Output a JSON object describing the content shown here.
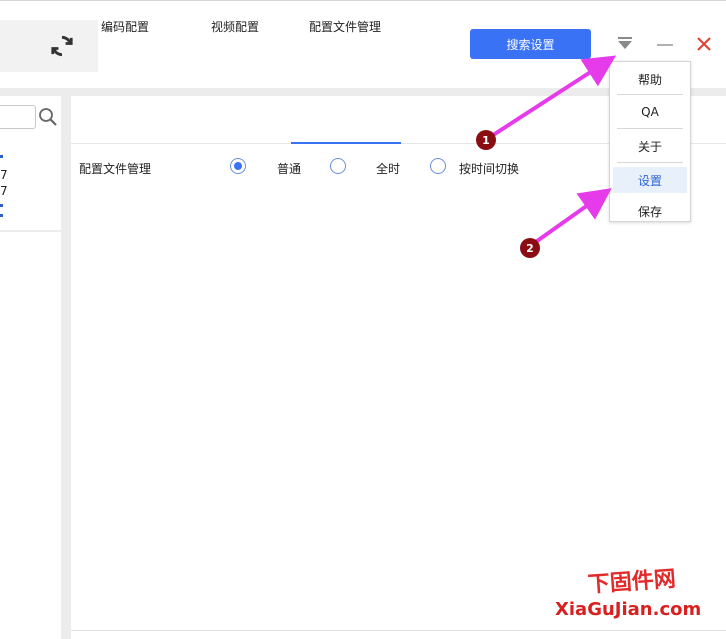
{
  "toolbar": {
    "search_settings_label": "搜索设置",
    "refresh_icon": "refresh-icon",
    "dropdown_icon": "dropdown-triangle-icon",
    "minimize_icon": "minimize-icon",
    "close_icon": "close-icon",
    "close_color": "#e0443c",
    "accent_color": "#3a72f5"
  },
  "left_panel": {
    "search_icon": "search-icon",
    "items": [
      "7",
      "7"
    ]
  },
  "tabs": [
    {
      "label": "编码配置"
    },
    {
      "label": "视频配置"
    },
    {
      "label": "配置文件管理",
      "active": true
    }
  ],
  "config_row": {
    "label": "配置文件管理",
    "options": [
      {
        "label": "普通",
        "checked": true
      },
      {
        "label": "全时",
        "checked": false
      },
      {
        "label": "按时间切换",
        "checked": false
      }
    ]
  },
  "menu": {
    "items": [
      {
        "label": "帮助"
      },
      {
        "label": "QA"
      },
      {
        "label": "关于"
      },
      {
        "label": "设置",
        "highlighted": true
      },
      {
        "label": "保存"
      }
    ]
  },
  "annotations": {
    "badges": [
      "1",
      "2"
    ],
    "arrow_color": "#e63bea",
    "badge_color": "#8b0d14"
  },
  "watermark": {
    "cn": "下固件网",
    "url": "XiaGuJian.com"
  }
}
